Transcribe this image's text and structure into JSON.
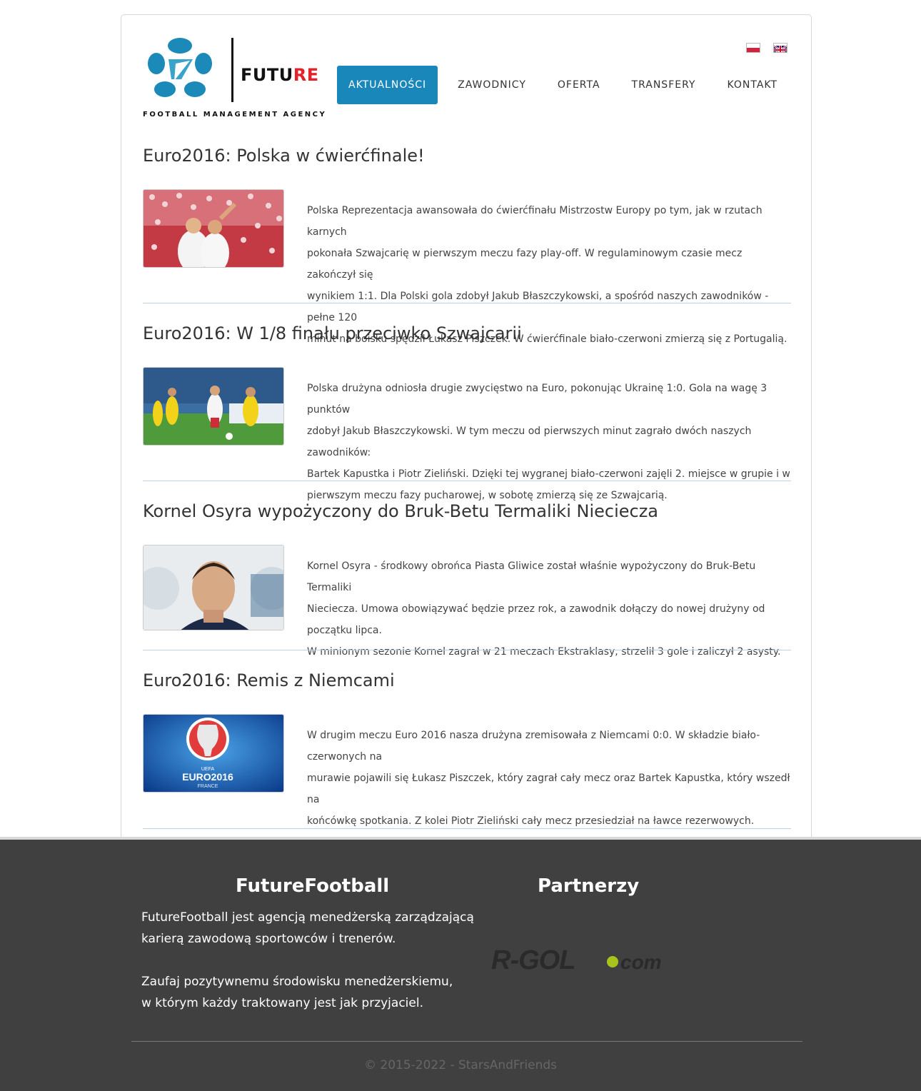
{
  "header": {
    "brand": "FUTURE",
    "brand_main": "FUTU",
    "brand_accent": "RE",
    "tagline": "FOOTBALL MANAGEMENT AGENCY",
    "languages": [
      "pl",
      "en"
    ]
  },
  "nav": {
    "items": [
      "AKTUALNOŚCI",
      "ZAWODNICY",
      "OFERTA",
      "TRANSFERY",
      "KONTAKT"
    ],
    "active": "AKTUALNOŚCI"
  },
  "articles": [
    {
      "title": "Euro2016: Polska w ćwierćfinale!",
      "lines": [
        "Polska Reprezentacja awansowała do ćwierćfinału Mistrzostw Europy po tym, jak w rzutach karnych",
        "pokonała Szwajcarię w pierwszym meczu fazy play-off. W regulaminowym czasie mecz zakończył się",
        "wynikiem 1:1. Dla Polski gola zdobył Jakub Błaszczykowski, a spośród naszych zawodników - pełne 120",
        "minut na boisku spędził Łukasz Piszczek. W ćwierćfinale biało-czerwoni zmierzą się z Portugalią."
      ]
    },
    {
      "title": "Euro2016: W 1/8 finału przeciwko Szwajcarii",
      "lines": [
        "Polska drużyna odniosła drugie zwycięstwo na Euro, pokonując Ukrainę 1:0. Gola na wagę 3 punktów",
        "zdobył Jakub Błaszczykowski. W tym meczu od pierwszych minut zagrało dwóch naszych zawodników:",
        "Bartek Kapustka i Piotr Zieliński. Dzięki tej wygranej biało-czerwoni zajęli 2. miejsce w grupie i w",
        "pierwszym meczu fazy pucharowej, w sobotę zmierzą się ze Szwajcarią."
      ]
    },
    {
      "title": "Kornel Osyra wypożyczony do Bruk-Betu Termaliki Nieciecza",
      "lines": [
        "Kornel Osyra - środkowy obrońca Piasta Gliwice został właśnie wypożyczony do Bruk-Betu Termaliki",
        "Nieciecza. Umowa obowiązywać będzie przez rok, a zawodnik dołączy do nowej drużyny od początku lipca.",
        "W minionym sezonie Kornel zagrał w 21 meczach Ekstraklasy, strzelił 3 gole i zaliczył 2 asysty."
      ]
    },
    {
      "title": "Euro2016: Remis z Niemcami",
      "lines": [
        "W drugim meczu Euro 2016 nasza drużyna zremisowała z Niemcami 0:0. W składzie biało-czerwonych na",
        "murawie pojawili się Łukasz Piszczek, który zagrał cały mecz oraz Bartek Kapustka, który wszedł na",
        "końcówkę spotkania. Z kolei Piotr Zieliński cały mecz przesiedział na ławce rezerwowych."
      ],
      "image_text": [
        "UEFA",
        "EURO2016",
        "FRANCE"
      ]
    }
  ],
  "footer": {
    "about_title": "FutureFootball",
    "about_lines": [
      "FutureFootball jest agencją menedżerską zarządzającą",
      "karierą zawodową sportowców i trenerów.",
      "Zaufaj pozytywnemu środowisku menedżerskiemu,",
      "w którym każdy traktowany jest jak przyjaciel."
    ],
    "partners_title": "Partnerzy",
    "partner_logo": "R-GOL.com",
    "copyright": "© 2015-2022 - StarsAndFriends"
  },
  "colors": {
    "accent": "#1a87ba",
    "brand_red": "#e3232b",
    "footer_bg": "#404040",
    "rule": "#bcd2e6",
    "partner_dot": "#a8c41c"
  }
}
